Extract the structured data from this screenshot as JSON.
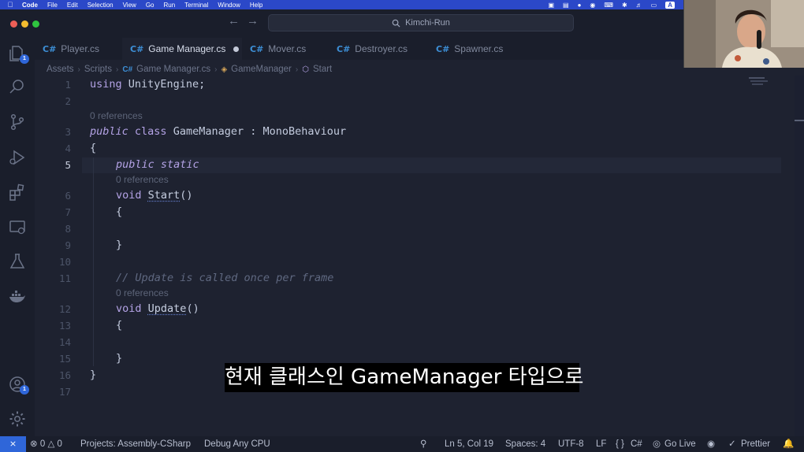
{
  "menubar": {
    "app": "Code",
    "items": [
      "File",
      "Edit",
      "Selection",
      "View",
      "Go",
      "Run",
      "Terminal",
      "Window",
      "Help"
    ],
    "status_chip": "A"
  },
  "titlebar": {
    "search_text": "Kimchi-Run"
  },
  "tabs": [
    {
      "label": "Player.cs",
      "active": false
    },
    {
      "label": "Game Manager.cs",
      "active": true,
      "modified": true
    },
    {
      "label": "Mover.cs",
      "active": false
    },
    {
      "label": "Destroyer.cs",
      "active": false
    },
    {
      "label": "Spawner.cs",
      "active": false
    }
  ],
  "tab_icon": "C#",
  "breadcrumb": {
    "parts": [
      "Assets",
      "Scripts",
      "Game Manager.cs",
      "GameManager",
      "Start"
    ]
  },
  "activity": {
    "explorer_badge": "1",
    "accounts_badge": "1"
  },
  "editor": {
    "line_numbers": [
      "1",
      "2",
      "3",
      "4",
      "5",
      "6",
      "7",
      "8",
      "9",
      "10",
      "11",
      "12",
      "13",
      "14",
      "15",
      "16",
      "17"
    ],
    "current_line": "5",
    "code": {
      "l1_kw": "using",
      "l1_rest": " UnityEngine;",
      "l3_kw1": "public",
      "l3_kw2": "class",
      "l3_rest": " GameManager : MonoBehaviour",
      "l4": "{",
      "l5": "public static",
      "l6_type": "void",
      "l6_fn": "Start",
      "l6_tail": "()",
      "l7": "{",
      "l9": "}",
      "l11": "// Update is called once per frame",
      "l12_type": "void",
      "l12_fn": "Update",
      "l12_tail": "()",
      "l13": "{",
      "l15": "}",
      "l16": "}"
    },
    "codelens": "0 references"
  },
  "subtitle": "현재 클래스인 GameManager 타입으로",
  "statusbar": {
    "remote_icon": "remote-icon",
    "errors": "0",
    "warnings": "0",
    "project": "Projects: Assembly-CSharp",
    "debug": "Debug Any CPU",
    "position": "Ln 5, Col 19",
    "spaces": "Spaces: 4",
    "encoding": "UTF-8",
    "eol": "LF",
    "language": "C#",
    "golive": "Go Live",
    "prettier": "Prettier"
  },
  "colors": {
    "accent": "#2f66d9",
    "menubar": "#2b48c8",
    "editor_bg": "#1e2230",
    "keyword": "#b4a3e6",
    "comment": "#5f6880"
  }
}
